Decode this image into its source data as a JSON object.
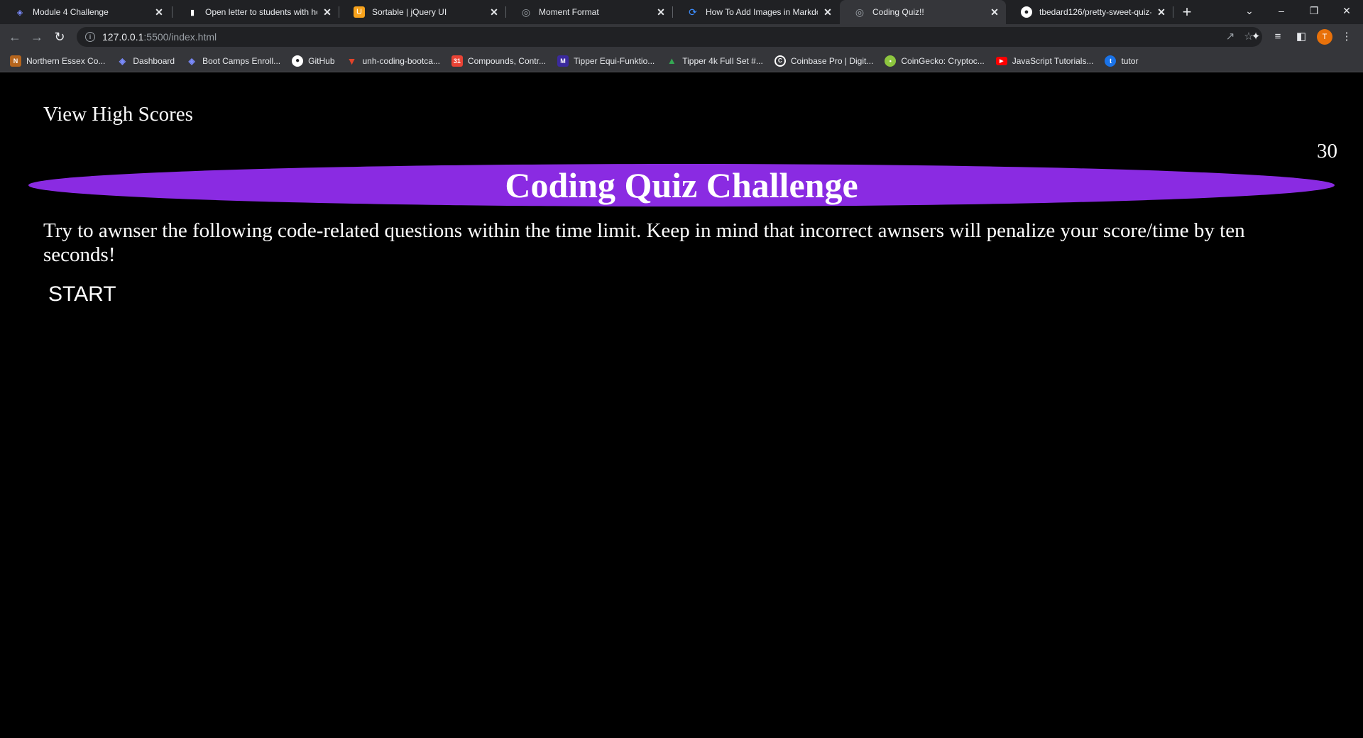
{
  "browser": {
    "tabs": [
      {
        "title": "Module 4 Challenge",
        "icon": "bootcamp-icon",
        "icon_color": "#2b3a9e"
      },
      {
        "title": "Open letter to students with ho",
        "icon": "document-icon",
        "icon_color": "#ffffff"
      },
      {
        "title": "Sortable | jQuery UI",
        "icon": "jquery-ui-icon",
        "icon_color": "#f7a21b"
      },
      {
        "title": "Moment Format",
        "icon": "globe-icon",
        "icon_color": "#9aa0a6"
      },
      {
        "title": "How To Add Images in Markdow",
        "icon": "digitalocean-icon",
        "icon_color": "#3d8eff"
      },
      {
        "title": "Coding Quiz!!",
        "icon": "globe-icon",
        "icon_color": "#9aa0a6",
        "active": true
      },
      {
        "title": "tbedard126/pretty-sweet-quiz-c",
        "icon": "github-icon",
        "icon_color": "#ffffff"
      }
    ],
    "address_bar": {
      "host": "127.0.0.1",
      "rest": ":5500/index.html"
    },
    "profile_initial": "T",
    "bookmarks": [
      {
        "label": "Northern Essex Co...",
        "icon": "school-icon",
        "icon_color": "#c0392b"
      },
      {
        "label": "Dashboard",
        "icon": "bootcamp-icon",
        "icon_color": "#2b3a9e"
      },
      {
        "label": "Boot Camps Enroll...",
        "icon": "bootcamp-icon",
        "icon_color": "#2b3a9e"
      },
      {
        "label": "GitHub",
        "icon": "github-icon",
        "icon_color": "#ffffff"
      },
      {
        "label": "unh-coding-bootca...",
        "icon": "gitlab-icon",
        "icon_color": "#e24329"
      },
      {
        "label": "Compounds, Contr...",
        "icon": "calendar-icon",
        "icon_color": "#ea4335"
      },
      {
        "label": "Tipper Equi-Funktio...",
        "icon": "tipper-icon",
        "icon_color": "#3b2a9e"
      },
      {
        "label": "Tipper 4k Full Set #...",
        "icon": "drive-icon",
        "icon_color": "#34a853"
      },
      {
        "label": "Coinbase Pro | Digit...",
        "icon": "coinbase-icon",
        "icon_color": "#ffffff"
      },
      {
        "label": "CoinGecko: Cryptoc...",
        "icon": "coingecko-icon",
        "icon_color": "#8dc63f"
      },
      {
        "label": "JavaScript Tutorials...",
        "icon": "youtube-icon",
        "icon_color": "#ff0000"
      },
      {
        "label": "tutor",
        "icon": "tutor-icon",
        "icon_color": "#1a73e8"
      }
    ]
  },
  "page": {
    "high_scores_link": "View High Scores",
    "timer": "30",
    "title": "Coding Quiz Challenge",
    "intro": "Try to awnser the following code-related questions within the time limit. Keep in mind that incorrect awnsers will penalize your score/time by ten seconds!",
    "start_label": "START"
  },
  "colors": {
    "banner": "#8a2be2",
    "page_background": "#000000",
    "text": "#ffffff"
  }
}
